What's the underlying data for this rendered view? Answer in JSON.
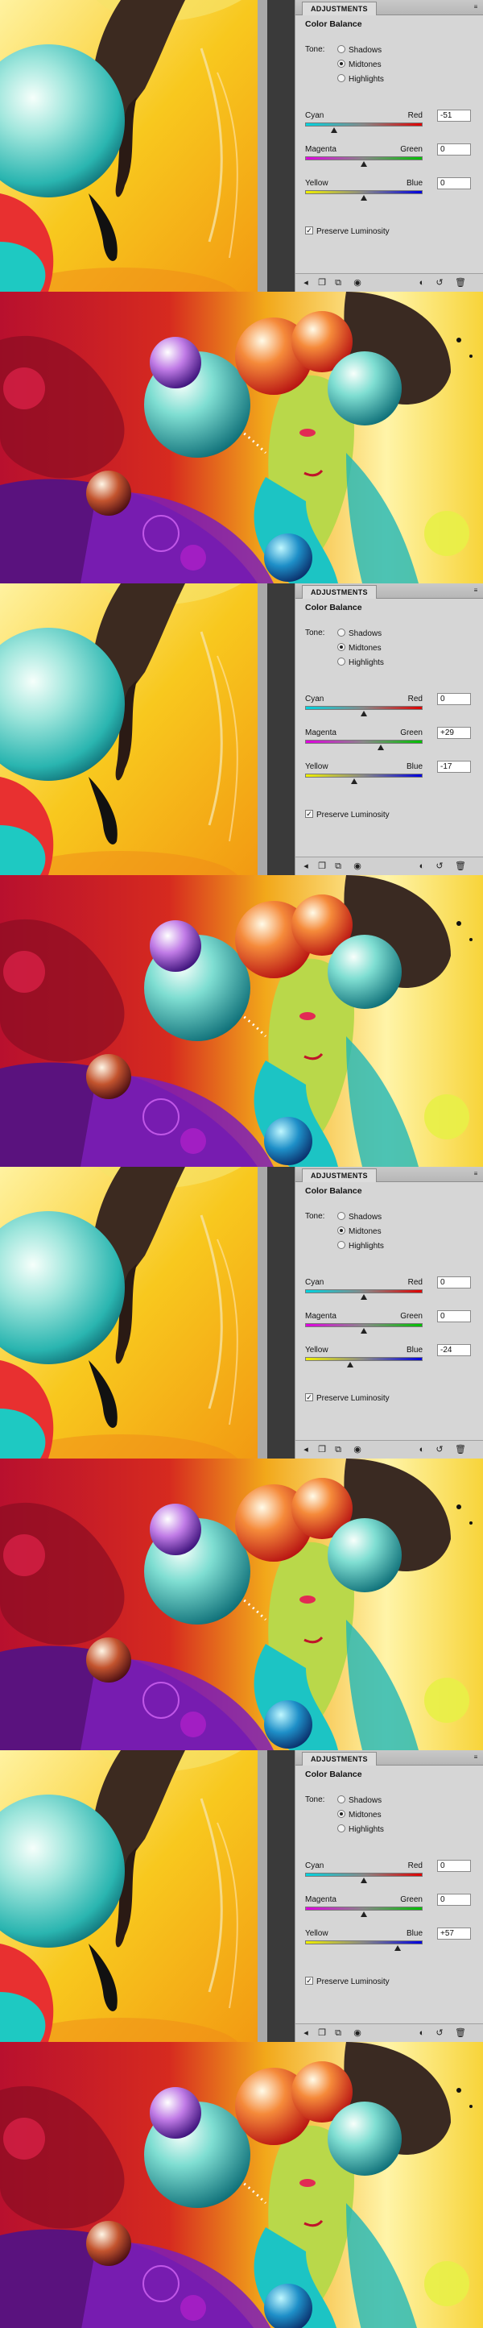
{
  "panels": [
    {
      "tab": "ADJUSTMENTS",
      "title": "Color Balance",
      "tone_label": "Tone:",
      "tones": [
        "Shadows",
        "Midtones",
        "Highlights"
      ],
      "selected_tone": "Midtones",
      "sliders": [
        {
          "left": "Cyan",
          "right": "Red",
          "value": "-51",
          "level": -51
        },
        {
          "left": "Magenta",
          "right": "Green",
          "value": "0",
          "level": 0
        },
        {
          "left": "Yellow",
          "right": "Blue",
          "value": "0",
          "level": 0
        }
      ],
      "preserve_label": "Preserve Luminosity",
      "preserve_checked": true
    },
    {
      "tab": "ADJUSTMENTS",
      "title": "Color Balance",
      "tone_label": "Tone:",
      "tones": [
        "Shadows",
        "Midtones",
        "Highlights"
      ],
      "selected_tone": "Midtones",
      "sliders": [
        {
          "left": "Cyan",
          "right": "Red",
          "value": "0",
          "level": 0
        },
        {
          "left": "Magenta",
          "right": "Green",
          "value": "+29",
          "level": 29
        },
        {
          "left": "Yellow",
          "right": "Blue",
          "value": "-17",
          "level": -17
        }
      ],
      "preserve_label": "Preserve Luminosity",
      "preserve_checked": true
    },
    {
      "tab": "ADJUSTMENTS",
      "title": "Color Balance",
      "tone_label": "Tone:",
      "tones": [
        "Shadows",
        "Midtones",
        "Highlights"
      ],
      "selected_tone": "Midtones",
      "sliders": [
        {
          "left": "Cyan",
          "right": "Red",
          "value": "0",
          "level": 0
        },
        {
          "left": "Magenta",
          "right": "Green",
          "value": "0",
          "level": 0
        },
        {
          "left": "Yellow",
          "right": "Blue",
          "value": "-24",
          "level": -24
        }
      ],
      "preserve_label": "Preserve Luminosity",
      "preserve_checked": true
    },
    {
      "tab": "ADJUSTMENTS",
      "title": "Color Balance",
      "tone_label": "Tone:",
      "tones": [
        "Shadows",
        "Midtones",
        "Highlights"
      ],
      "selected_tone": "Midtones",
      "sliders": [
        {
          "left": "Cyan",
          "right": "Red",
          "value": "0",
          "level": 0
        },
        {
          "left": "Magenta",
          "right": "Green",
          "value": "0",
          "level": 0
        },
        {
          "left": "Yellow",
          "right": "Blue",
          "value": "+57",
          "level": 57
        }
      ],
      "preserve_label": "Preserve Luminosity",
      "preserve_checked": true
    }
  ],
  "footer_icons": [
    "return-to-list-icon",
    "new-layer-icon",
    "clip-to-layer-icon",
    "visibility-eye-icon",
    "view-previous-icon",
    "reset-icon",
    "delete-icon"
  ],
  "colors": {
    "panel_bg": "#d6d6d6",
    "canvas_dark": "#3a3a3a",
    "art_yellow": "#f6c21a",
    "art_red": "#c0122a",
    "art_purple": "#6a1aa8",
    "sphere_cyan": "#38c6c0"
  }
}
